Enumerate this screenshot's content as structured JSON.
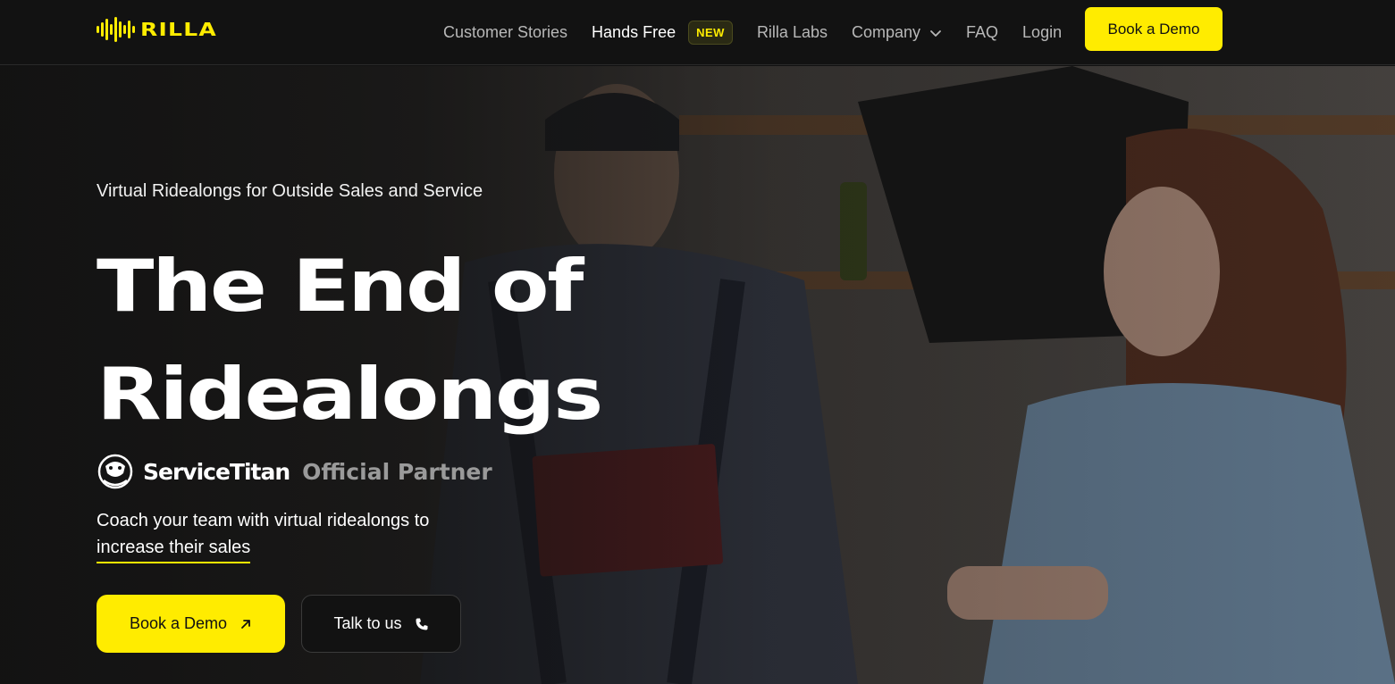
{
  "nav": {
    "logo_text": "RILLA",
    "links": [
      {
        "label": "Customer Stories"
      },
      {
        "label": "Hands Free",
        "badge": "NEW"
      },
      {
        "label": "Rilla Labs"
      },
      {
        "label": "Company"
      },
      {
        "label": "FAQ"
      },
      {
        "label": "Login"
      }
    ],
    "cta": "Book a Demo"
  },
  "hero": {
    "eyebrow": "Virtual Ridealongs for Outside Sales and Service",
    "headline_line1": "The End of",
    "headline_line2": "Ridealongs",
    "partner_name": "ServiceTitan",
    "partner_tag": "Official Partner",
    "sub_line1": "Coach your team with virtual ridealongs to",
    "sub_highlight": "increase their sales",
    "primary_button": "Book a Demo",
    "secondary_button": "Talk to us"
  },
  "colors": {
    "accent": "#ffec00",
    "background": "#111111"
  },
  "icons": [
    "rilla-logo-icon",
    "chevron-down-icon",
    "servicetitan-logo-icon",
    "arrow-up-right-icon",
    "phone-icon"
  ]
}
